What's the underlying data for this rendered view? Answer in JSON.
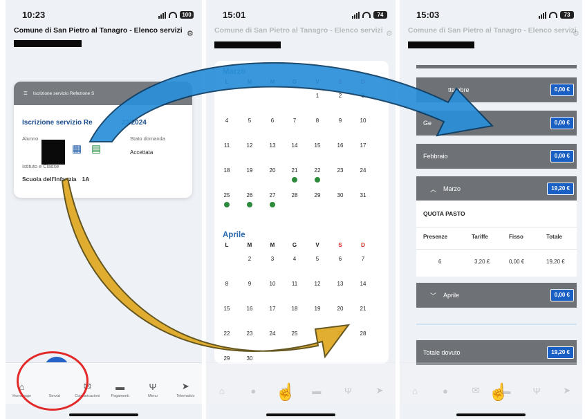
{
  "screen1": {
    "time": "10:23",
    "battery": "100",
    "app_title": "Comune di San Pietro al Tanagro - Elenco servizi",
    "card_header": "Iscrizione servizio Refezione S",
    "card_title": "Iscrizione servizio Re",
    "card_title_date": "23/2024",
    "label_alunno": "Alunno",
    "label_stato": "Stato domanda",
    "stato_value": "Accettata",
    "label_istituto": "Istituto e Classe",
    "school": "Scuola dell'Infanzia",
    "class": "1A",
    "nav": [
      {
        "label": "Homepage",
        "icon": "home-icon"
      },
      {
        "label": "Servizi",
        "icon": "people-icon"
      },
      {
        "label": "Comunicazioni",
        "icon": "mail-icon"
      },
      {
        "label": "Pagamenti",
        "icon": "wallet-icon"
      },
      {
        "label": "Menu",
        "icon": "cutlery-icon"
      },
      {
        "label": "Telematico",
        "icon": "send-icon"
      }
    ]
  },
  "screen2": {
    "time": "15:01",
    "battery": "74",
    "app_title": "Comune di San Pietro al Tanagro - Elenco servizi",
    "weekdays": [
      "L",
      "M",
      "M",
      "G",
      "V",
      "S",
      "D"
    ],
    "march": {
      "name": "Marzo",
      "rows": [
        [
          "",
          "",
          "",
          "",
          "1",
          "2",
          "3"
        ],
        [
          "4",
          "5",
          "6",
          "7",
          "8",
          "9",
          "10"
        ],
        [
          "11",
          "12",
          "13",
          "14",
          "15",
          "16",
          "17"
        ],
        [
          "18",
          "19",
          "20",
          "21",
          "22",
          "23",
          "24"
        ],
        [
          "25",
          "26",
          "27",
          "28",
          "29",
          "30",
          "31"
        ]
      ],
      "attended": [
        "21",
        "22",
        "25",
        "26",
        "27"
      ]
    },
    "april": {
      "name": "Aprile",
      "rows": [
        [
          "",
          "2",
          "3",
          "4",
          "5",
          "6",
          "7"
        ],
        [
          "8",
          "9",
          "10",
          "11",
          "12",
          "13",
          "14"
        ],
        [
          "15",
          "16",
          "17",
          "18",
          "19",
          "20",
          "21"
        ],
        [
          "22",
          "23",
          "24",
          "25",
          "",
          "27",
          "28"
        ],
        [
          "29",
          "30",
          "",
          "",
          "",
          "",
          ""
        ]
      ]
    }
  },
  "screen3": {
    "time": "15:03",
    "battery": "73",
    "app_title": "Comune di San Pietro al Tanagro - Elenco servizi",
    "rows": [
      {
        "label": "ttembre",
        "amount": "0,00 €"
      },
      {
        "label": "Ge",
        "amount": "0,00 €"
      },
      {
        "label": "Febbraio",
        "amount": "0,00 €"
      },
      {
        "label": "Marzo",
        "amount": "19,20 €"
      },
      {
        "label": "Aprile",
        "amount": "0,00 €"
      }
    ],
    "quota_title": "QUOTA PASTO",
    "table_headers": [
      "Presenze",
      "Tariffe",
      "Fisso",
      "Totale"
    ],
    "table_row": [
      "6",
      "3,20 €",
      "0,00 €",
      "19,20 €"
    ],
    "total_label": "Totale dovuto",
    "total_amount": "19,20 €"
  },
  "colors": {
    "accent_blue": "#1a5fc4",
    "header_gray": "#6e7277",
    "attendance_green": "#2d8a3a",
    "weekend_red": "#d0281f",
    "highlight_circle": "#e32a2a",
    "arrow_blue": "#2a8fd8",
    "arrow_gold": "#e0a820"
  }
}
